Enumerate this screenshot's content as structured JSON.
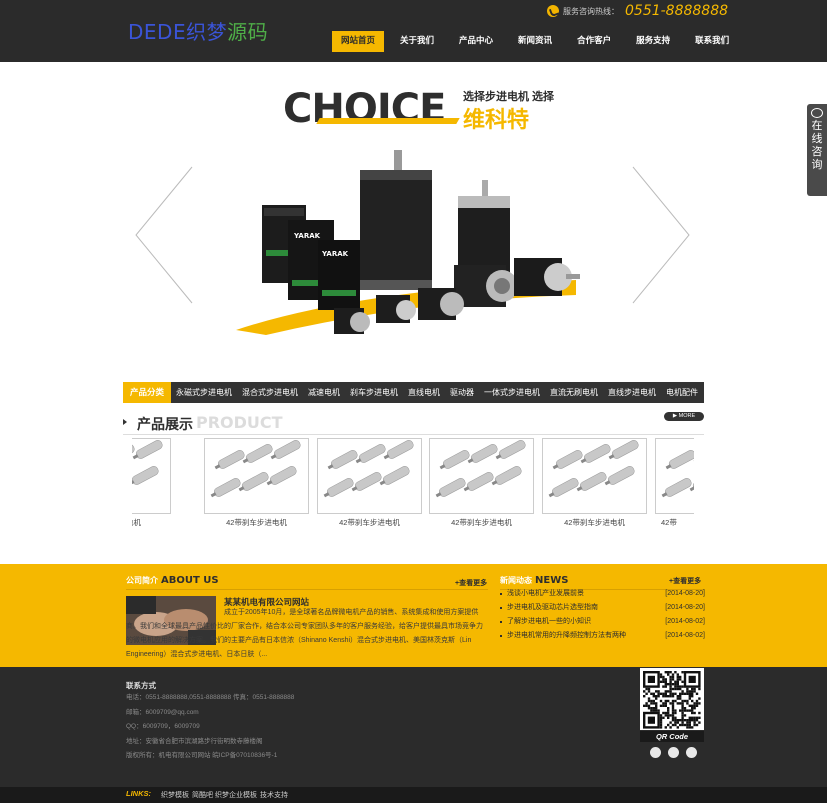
{
  "header": {
    "logo_en": "DEDE",
    "logo_cn1": "织梦",
    "logo_cn2": "源码",
    "hotline_label": "服务咨询热线：",
    "hotline_number": "0551-8888888",
    "nav": [
      "网站首页",
      "关于我们",
      "产品中心",
      "新闻资讯",
      "合作客户",
      "服务支持",
      "联系我们"
    ]
  },
  "banner": {
    "headline": "CHOICE",
    "tagline_1": "选择步进电机 选择",
    "tagline_2": "维科特",
    "driver_brand": "YARAK"
  },
  "online": {
    "label": "在线咨询"
  },
  "categories": {
    "title": "产品分类",
    "items": [
      "永磁式步进电机",
      "混合式步进电机",
      "减速电机",
      "刹车步进电机",
      "直线电机",
      "驱动器",
      "一体式步进电机",
      "直流无刷电机",
      "直线步进电机",
      "电机配件"
    ]
  },
  "products": {
    "title_cn": "产品展示",
    "title_en": "PRODUCT",
    "more": "MORE",
    "items": [
      {
        "caption": "刹车步进电机"
      },
      {
        "caption": "42带刹车步进电机"
      },
      {
        "caption": "42带刹车步进电机"
      },
      {
        "caption": "42带刹车步进电机"
      },
      {
        "caption": "42带刹车步进电机"
      },
      {
        "caption": "42带"
      }
    ]
  },
  "about": {
    "label_cn": "公司简介",
    "label_en": "ABOUT US",
    "more": "+查看更多",
    "company": "某某机电有限公司网站",
    "text": "成立于2005年10月，是全球著名品牌微电机产品的销售、系统集成和使用方案提供商。我们和全球最具产品性价比的厂家合作，结合本公司专家团队多年的客户服务经验，给客户提供最具市场竞争力的微电机应用的解决方案。我们的主要产品有日本信浓（Shinano Kenshi）混合式步进电机、美国林茨克斯（Lin Engineering）混合式步进电机、日本日肤（..."
  },
  "news": {
    "label_cn": "新闻动态",
    "label_en": "NEWS",
    "more": "+查看更多",
    "items": [
      {
        "title": "浅谈小电机产业发展前景",
        "date": "[2014-08-20]"
      },
      {
        "title": "步进电机及驱动芯片选型指南",
        "date": "[2014-08-20]"
      },
      {
        "title": "了解步进电机一些的小知识",
        "date": "[2014-08-02]"
      },
      {
        "title": "步进电机常用的升降频控制方法有两种",
        "date": "[2014-08-02]"
      }
    ]
  },
  "footer": {
    "contact_title": "联系方式",
    "lines": [
      "电话：0551-8888888,0551-8888888  传真：0551-8888888",
      "邮箱：6009709@qq.com",
      "QQ：6009709，6009709",
      "地址：安徽省合肥市滨湖路步行街明数寺藤楼阁",
      "版权所有：机电有限公司网站  皖ICP备07010836号-1"
    ],
    "qr_label": "QR Code"
  },
  "links": {
    "label": "LINKS:",
    "items": [
      "织梦模板",
      "简酷吧",
      "织梦企业模板",
      "技术支持"
    ]
  }
}
